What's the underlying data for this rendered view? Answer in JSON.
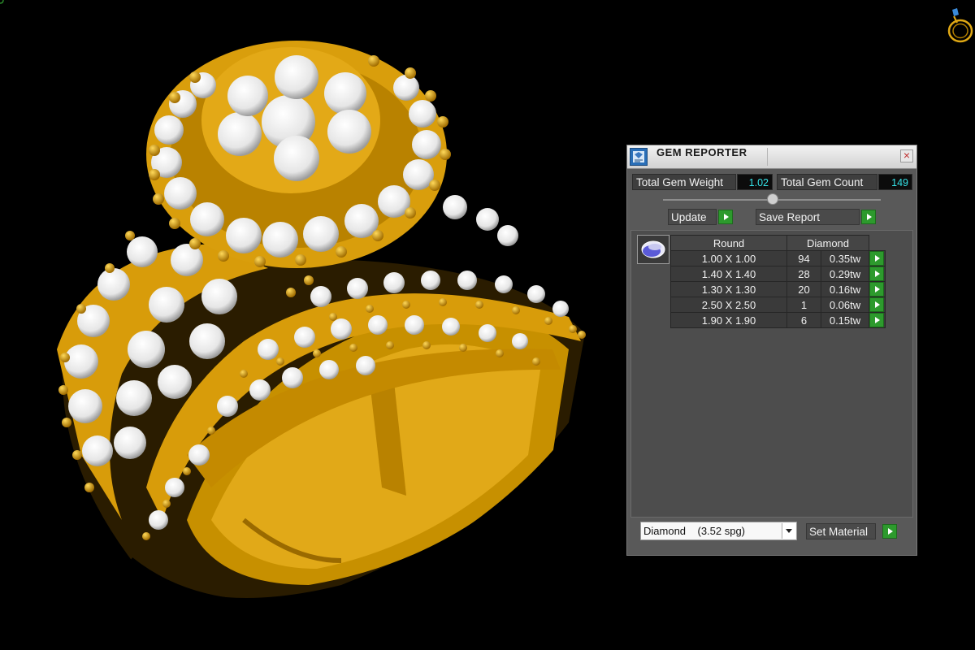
{
  "panel": {
    "title": "GEM REPORTER",
    "close_glyph": "×",
    "total_weight_label": "Total Gem Weight",
    "total_weight_value": "1.02",
    "total_count_label": "Total Gem Count",
    "total_count_value": "149",
    "update_label": "Update",
    "save_report_label": "Save Report",
    "table": {
      "headers": [
        "Round",
        "Diamond"
      ],
      "rows": [
        {
          "size": "1.00 X 1.00",
          "count": "94",
          "weight": "0.35tw"
        },
        {
          "size": "1.40 X 1.40",
          "count": "28",
          "weight": "0.29tw"
        },
        {
          "size": "1.30 X 1.30",
          "count": "20",
          "weight": "0.16tw"
        },
        {
          "size": "2.50 X 2.50",
          "count": "1",
          "weight": "0.06tw"
        },
        {
          "size": "1.90 X 1.90",
          "count": "6",
          "weight": "0.15tw"
        }
      ]
    },
    "material_name": "Diamond",
    "material_spg": "(3.52 spg)",
    "set_material_label": "Set Material"
  },
  "colors": {
    "gold": "#e0a814",
    "gem": "#f2f2f2",
    "value_text": "#35e3e8",
    "play_green": "#2d9a2d"
  },
  "icons": [
    "gem-reporter-icon",
    "close-icon",
    "play-icon",
    "view-cube-icon",
    "dropdown-arrow-icon",
    "round-gem-icon"
  ]
}
